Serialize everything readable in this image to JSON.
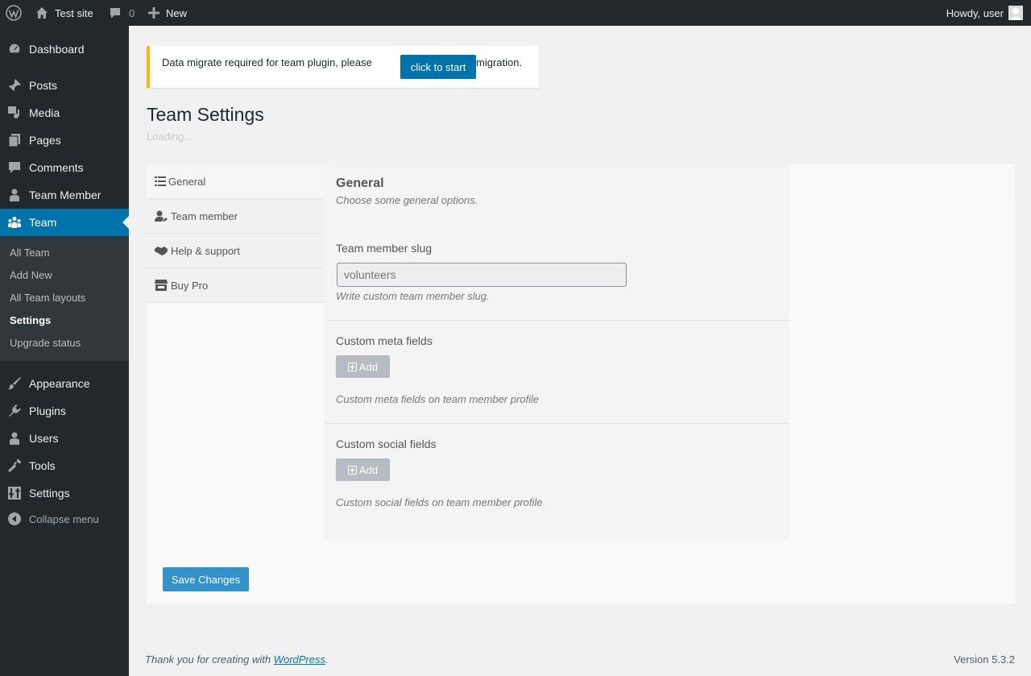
{
  "admin_bar": {
    "site_name": "Test site",
    "comments_count": "0",
    "new_label": "New",
    "howdy": "Howdy, user"
  },
  "sidebar": {
    "items": [
      {
        "label": "Dashboard",
        "icon": "dashboard-icon"
      },
      {
        "label": "Posts",
        "icon": "pushpin-icon"
      },
      {
        "label": "Media",
        "icon": "media-icon"
      },
      {
        "label": "Pages",
        "icon": "pages-icon"
      },
      {
        "label": "Comments",
        "icon": "comment-icon"
      },
      {
        "label": "Team Member",
        "icon": "user-icon"
      },
      {
        "label": "Team",
        "icon": "groups-icon"
      },
      {
        "label": "Appearance",
        "icon": "paintbrush-icon"
      },
      {
        "label": "Plugins",
        "icon": "plugin-icon"
      },
      {
        "label": "Users",
        "icon": "users-icon"
      },
      {
        "label": "Tools",
        "icon": "wrench-icon"
      },
      {
        "label": "Settings",
        "icon": "settings-icon"
      }
    ],
    "submenu": [
      "All Team",
      "Add New",
      "All Team layouts",
      "Settings",
      "Upgrade status"
    ],
    "collapse_label": "Collapse menu"
  },
  "notice": {
    "text_before": "Data migrate required for team plugin, please",
    "button": "click to start",
    "text_after": "migration."
  },
  "page": {
    "title": "Team Settings",
    "loading": "Loading..."
  },
  "tabs": [
    {
      "label": "General",
      "icon": "list-icon"
    },
    {
      "label": "Team member",
      "icon": "user-edit-icon"
    },
    {
      "label": "Help & support",
      "icon": "handshake-icon"
    },
    {
      "label": "Buy Pro",
      "icon": "store-icon"
    }
  ],
  "general": {
    "title": "General",
    "description": "Choose some general options.",
    "slug_label": "Team member slug",
    "slug_placeholder": "volunteers",
    "slug_desc": "Write custom team member slug.",
    "meta_label": "Custom meta fields",
    "meta_add": "Add",
    "meta_desc": "Custom meta fields on team member profile",
    "social_label": "Custom social fields",
    "social_add": "Add",
    "social_desc": "Custom social fields on team member profile"
  },
  "save_button": "Save Changes",
  "footer": {
    "thanks_before": "Thank you for creating with ",
    "thanks_link": "WordPress",
    "thanks_after": ".",
    "version": "Version 5.3.2"
  },
  "colors": {
    "admin_dark": "#23282d",
    "accent_blue": "#0073aa",
    "notice_warning": "#ffb900"
  }
}
